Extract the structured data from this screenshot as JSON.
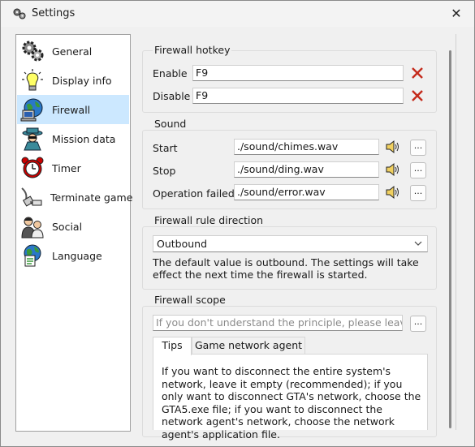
{
  "window": {
    "title": "Settings"
  },
  "sidebar": {
    "items": [
      {
        "label": "General",
        "icon": "gears-icon"
      },
      {
        "label": "Display info",
        "icon": "lightbulb-icon"
      },
      {
        "label": "Firewall",
        "icon": "network-computer-icon",
        "active": true
      },
      {
        "label": "Mission data",
        "icon": "spy-icon"
      },
      {
        "label": "Timer",
        "icon": "alarm-clock-icon"
      },
      {
        "label": "Terminate game",
        "icon": "unplug-icon"
      },
      {
        "label": "Social",
        "icon": "people-icon"
      },
      {
        "label": "Language",
        "icon": "globe-document-icon"
      }
    ]
  },
  "hotkey": {
    "title": "Firewall hotkey",
    "enable_label": "Enable",
    "enable_value": "F9",
    "disable_label": "Disable",
    "disable_value": "F9"
  },
  "sound": {
    "title": "Sound",
    "rows": [
      {
        "label": "Start",
        "value": "./sound/chimes.wav"
      },
      {
        "label": "Stop",
        "value": "./sound/ding.wav"
      },
      {
        "label": "Operation failed",
        "value": "./sound/error.wav"
      }
    ],
    "browse_label": "..."
  },
  "direction": {
    "title": "Firewall rule direction",
    "selected": "Outbound",
    "note": "The default value is outbound. The settings will take effect the next time the firewall is started."
  },
  "scope": {
    "title": "Firewall scope",
    "placeholder": "If you don't understand the principle, please leave...",
    "browse_label": "...",
    "tabs": [
      "Tips",
      "Game network agent"
    ],
    "tips_text": "If you want to disconnect the entire system's network, leave it empty (recommended); if you only want to disconnect GTA's network, choose the GTA5.exe file; if you want to disconnect the network agent's network, choose the network agent's application file."
  },
  "colors": {
    "active_item": "#cce8ff",
    "clear_icon": "#c42b1c"
  }
}
